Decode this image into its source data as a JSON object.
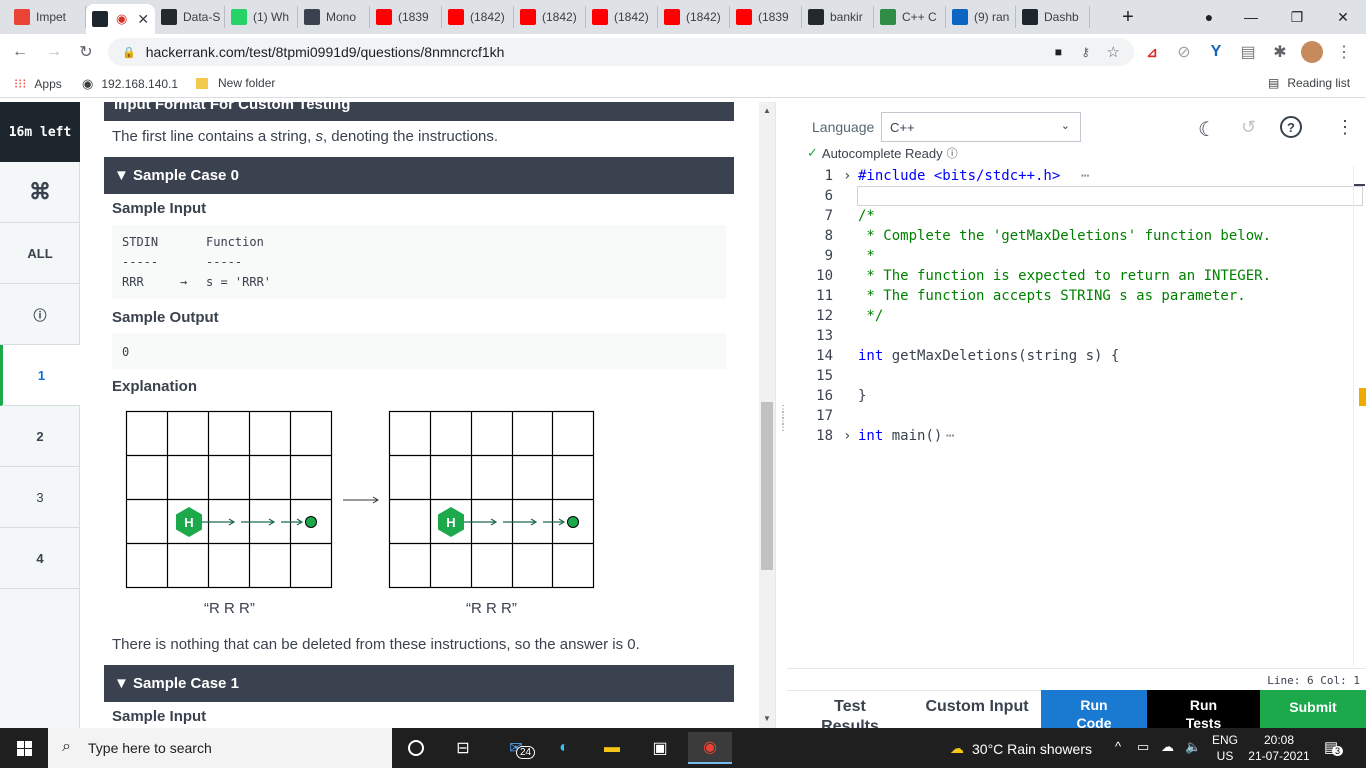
{
  "browser": {
    "tabs": [
      {
        "label": "Impet",
        "icon": "gmail-icon",
        "color": "#ea4335"
      },
      {
        "label": "",
        "icon": "hackerrank-icon",
        "color": "#1d262d",
        "active": true
      },
      {
        "label": "Data-S",
        "icon": "github-icon",
        "color": "#24292e"
      },
      {
        "label": "(1) Wh",
        "icon": "whatsapp-icon",
        "color": "#25d366"
      },
      {
        "label": "Mono",
        "icon": "hashnode-icon",
        "color": "#39424e"
      },
      {
        "label": "(1839",
        "icon": "youtube-icon",
        "color": "#ff0000"
      },
      {
        "label": "(1842)",
        "icon": "youtube-icon",
        "color": "#ff0000"
      },
      {
        "label": "(1842)",
        "icon": "youtube-icon",
        "color": "#ff0000"
      },
      {
        "label": "(1842)",
        "icon": "youtube-icon",
        "color": "#ff0000"
      },
      {
        "label": "(1842)",
        "icon": "youtube-icon",
        "color": "#ff0000"
      },
      {
        "label": "(1839",
        "icon": "youtube-icon",
        "color": "#ff0000"
      },
      {
        "label": "bankir",
        "icon": "github-icon",
        "color": "#24292e"
      },
      {
        "label": "C++ C",
        "icon": "geeksforgeeks-icon",
        "color": "#2f8d46"
      },
      {
        "label": "(9) ran",
        "icon": "linkedin-icon",
        "color": "#0a66c2"
      },
      {
        "label": "Dashb",
        "icon": "hackerrank-icon",
        "color": "#1d262d"
      }
    ],
    "url": "hackerrank.com/test/8tpmi0991d9/questions/8nmncrcf1kh",
    "bookmarks": {
      "apps": "Apps",
      "ip": "192.168.140.1",
      "folder": "New folder",
      "reading_list": "Reading list"
    }
  },
  "leftnav": {
    "timer": "16m left",
    "items": [
      {
        "label": "⌘",
        "icon": "command-icon"
      },
      {
        "label": "ALL"
      },
      {
        "label": "ⓘ",
        "icon": "info-icon"
      },
      {
        "label": "1",
        "active": true
      },
      {
        "label": "2"
      },
      {
        "label": "3"
      },
      {
        "label": "4"
      }
    ]
  },
  "problem": {
    "input_format_header": "Input Format For Custom Testing",
    "input_format_text_before": "The first line contains a string, ",
    "input_format_var": "s",
    "input_format_text_after": ", denoting the instructions.",
    "sample0_title": "▼ Sample Case 0",
    "sample_input_label": "Sample Input",
    "stdin_col": "STDIN",
    "function_col": "Function",
    "dashes": "-----",
    "input_value": "RRR",
    "arrow": "→",
    "function_value": "s = 'RRR'",
    "sample_output_label": "Sample Output",
    "output_value": "0",
    "explanation_label": "Explanation",
    "grid_caption_left": "“R R R”",
    "grid_caption_right": "“R R R”",
    "robot_letter": "H",
    "explanation_text": "There is nothing that can be deleted from these instructions, so the answer is 0.",
    "sample1_title": "▼ Sample Case 1",
    "sample1_input_label": "Sample Input"
  },
  "editor": {
    "language_label": "Language",
    "language_value": "C++",
    "autocomplete": "Autocomplete Ready",
    "lines": [
      {
        "n": "1",
        "text": "#include <bits/stdc++.h>"
      },
      {
        "n": "6",
        "text": ""
      },
      {
        "n": "7",
        "text": "/*"
      },
      {
        "n": "8",
        "text": " * Complete the 'getMaxDeletions' function below."
      },
      {
        "n": "9",
        "text": " *"
      },
      {
        "n": "10",
        "text": " * The function is expected to return an INTEGER."
      },
      {
        "n": "11",
        "text": " * The function accepts STRING s as parameter."
      },
      {
        "n": "12",
        "text": " */"
      },
      {
        "n": "13",
        "text": ""
      },
      {
        "n": "14",
        "text": "int getMaxDeletions(string s) {"
      },
      {
        "n": "15",
        "text": ""
      },
      {
        "n": "16",
        "text": "}"
      },
      {
        "n": "17",
        "text": ""
      },
      {
        "n": "18",
        "text": "int main()"
      }
    ],
    "fold_ellipsis": "⋯",
    "status": "Line: 6 Col: 1",
    "buttons": {
      "test_results": "Test Results",
      "custom_input": "Custom Input",
      "run_code": "Run Code",
      "run_tests": "Run Tests",
      "submit": "Submit"
    }
  },
  "taskbar": {
    "search_placeholder": "Type here to search",
    "mail_badge": "24",
    "weather": "30°C  Rain showers",
    "lang_top": "ENG",
    "lang_bottom": "US",
    "time": "20:08",
    "date": "21-07-2021",
    "notif_count": "3"
  },
  "colors": {
    "hackerrank_green": "#1ba94c",
    "run_code_blue": "#1a7ad1",
    "dark": "#39424e"
  }
}
